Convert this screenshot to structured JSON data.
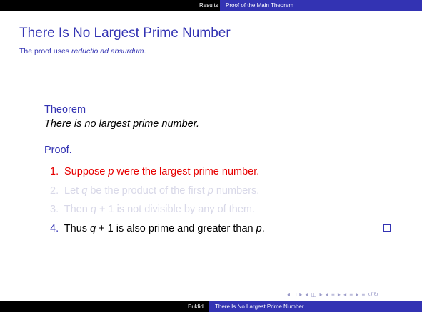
{
  "header": {
    "section_prev": "Results",
    "section_current": "Proof of the Main Theorem"
  },
  "frame": {
    "title": "There Is No Largest Prime Number",
    "subtitle_prefix": "The proof uses ",
    "subtitle_emph": "reductio ad absurdum",
    "subtitle_suffix": "."
  },
  "theorem": {
    "heading": "Theorem",
    "statement": "There is no largest prime number."
  },
  "proof": {
    "heading": "Proof.",
    "steps": [
      {
        "num": "1.",
        "parts": [
          "Suppose ",
          "p",
          " were the largest prime number."
        ]
      },
      {
        "num": "2.",
        "parts": [
          "Let ",
          "q",
          " be the product of the first ",
          "p",
          " numbers."
        ]
      },
      {
        "num": "3.",
        "parts": [
          "Then ",
          "q",
          " + 1 is not divisible by any of them."
        ]
      },
      {
        "num": "4.",
        "parts": [
          "Thus ",
          "q",
          " + 1 is also prime and greater than ",
          "p",
          "."
        ]
      }
    ]
  },
  "navigation": {
    "symbols": "◂ □ ▸ ◂ ◫ ▸ ◂ ≡ ▸ ◂ ≡ ▸ ≡ ↺↻"
  },
  "footer": {
    "author": "Euklid",
    "short_title": "There Is No Largest Prime Number"
  },
  "colors": {
    "structure": "#3333b3",
    "alert": "#e60000",
    "covered": "#d8d8e8"
  }
}
